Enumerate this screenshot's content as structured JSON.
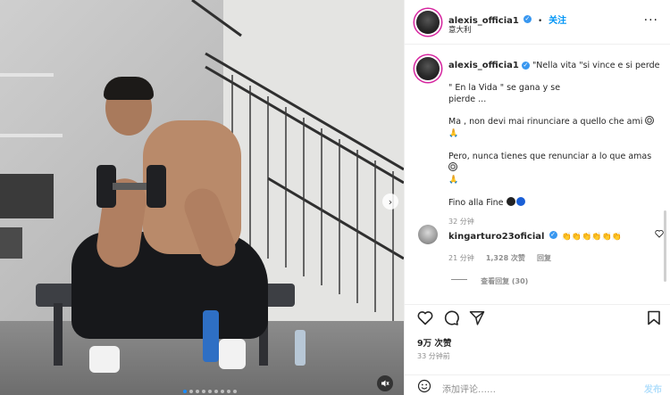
{
  "post": {
    "author": "alexis_officia1",
    "follow_label": "关注",
    "location": "意大利",
    "more_label": "···"
  },
  "caption": {
    "author": "alexis_officia1",
    "line1": "\"Nella vita \"si vince e si perde",
    "line2": "\" En la Vida \" se gana y se",
    "line3": "pierde ...",
    "line4": "Ma , non devi mai rinunciare a quello che ami",
    "line5": "Pero, nunca tienes que renunciar a lo que amas",
    "line6": "Fino alla Fine",
    "time": "32 分钟"
  },
  "comment": {
    "author": "kingarturo23oficial",
    "emojis": "👏👏👏👏👏👏",
    "time": "21 分钟",
    "likes": "1,328 次赞",
    "reply": "回复",
    "view_replies": "查看回复 (30)"
  },
  "stats": {
    "likes": "9万 次赞",
    "time": "33 分钟前"
  },
  "composer": {
    "placeholder": "添加评论……",
    "post_label": "发布"
  },
  "carousel": {
    "dots_total": 9,
    "active_index": 0
  },
  "colors": {
    "accent": "#0095f6",
    "verified": "#3897f0",
    "story_ring": "#d6249f",
    "post_button_disabled": "#b2dffc"
  }
}
